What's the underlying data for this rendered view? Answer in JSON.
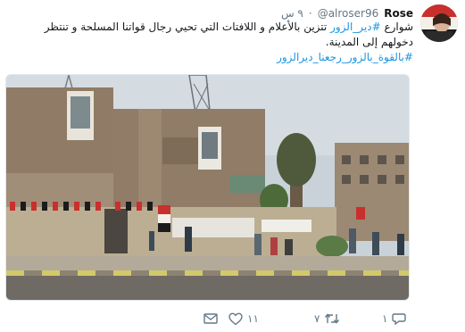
{
  "tweet": {
    "display_name": "Rose",
    "handle": "@alroser96",
    "separator": "·",
    "time": "٩ س",
    "text_line_1_pre": "شوارع ",
    "text_line_1_hashtag": "#دير_الزور",
    "text_line_1_post": " تتزين بالأعلام و اللافتات التي تحيي رجال قواتنا المسلحة و تنتظر",
    "text_line_2": "دخولهم إلى المدينة.",
    "text_line_3_hashtag": "#بالقوة_بالزور_رجعنا_ديرالزور"
  },
  "actions": {
    "reply_count": "١",
    "retweet_count": "٧",
    "like_count": "١١"
  },
  "icons": {
    "reply": "reply-icon",
    "retweet": "retweet-icon",
    "like": "heart-icon",
    "message": "envelope-icon"
  },
  "colors": {
    "link": "#1b95e0",
    "muted": "#657786",
    "text": "#14171a"
  }
}
